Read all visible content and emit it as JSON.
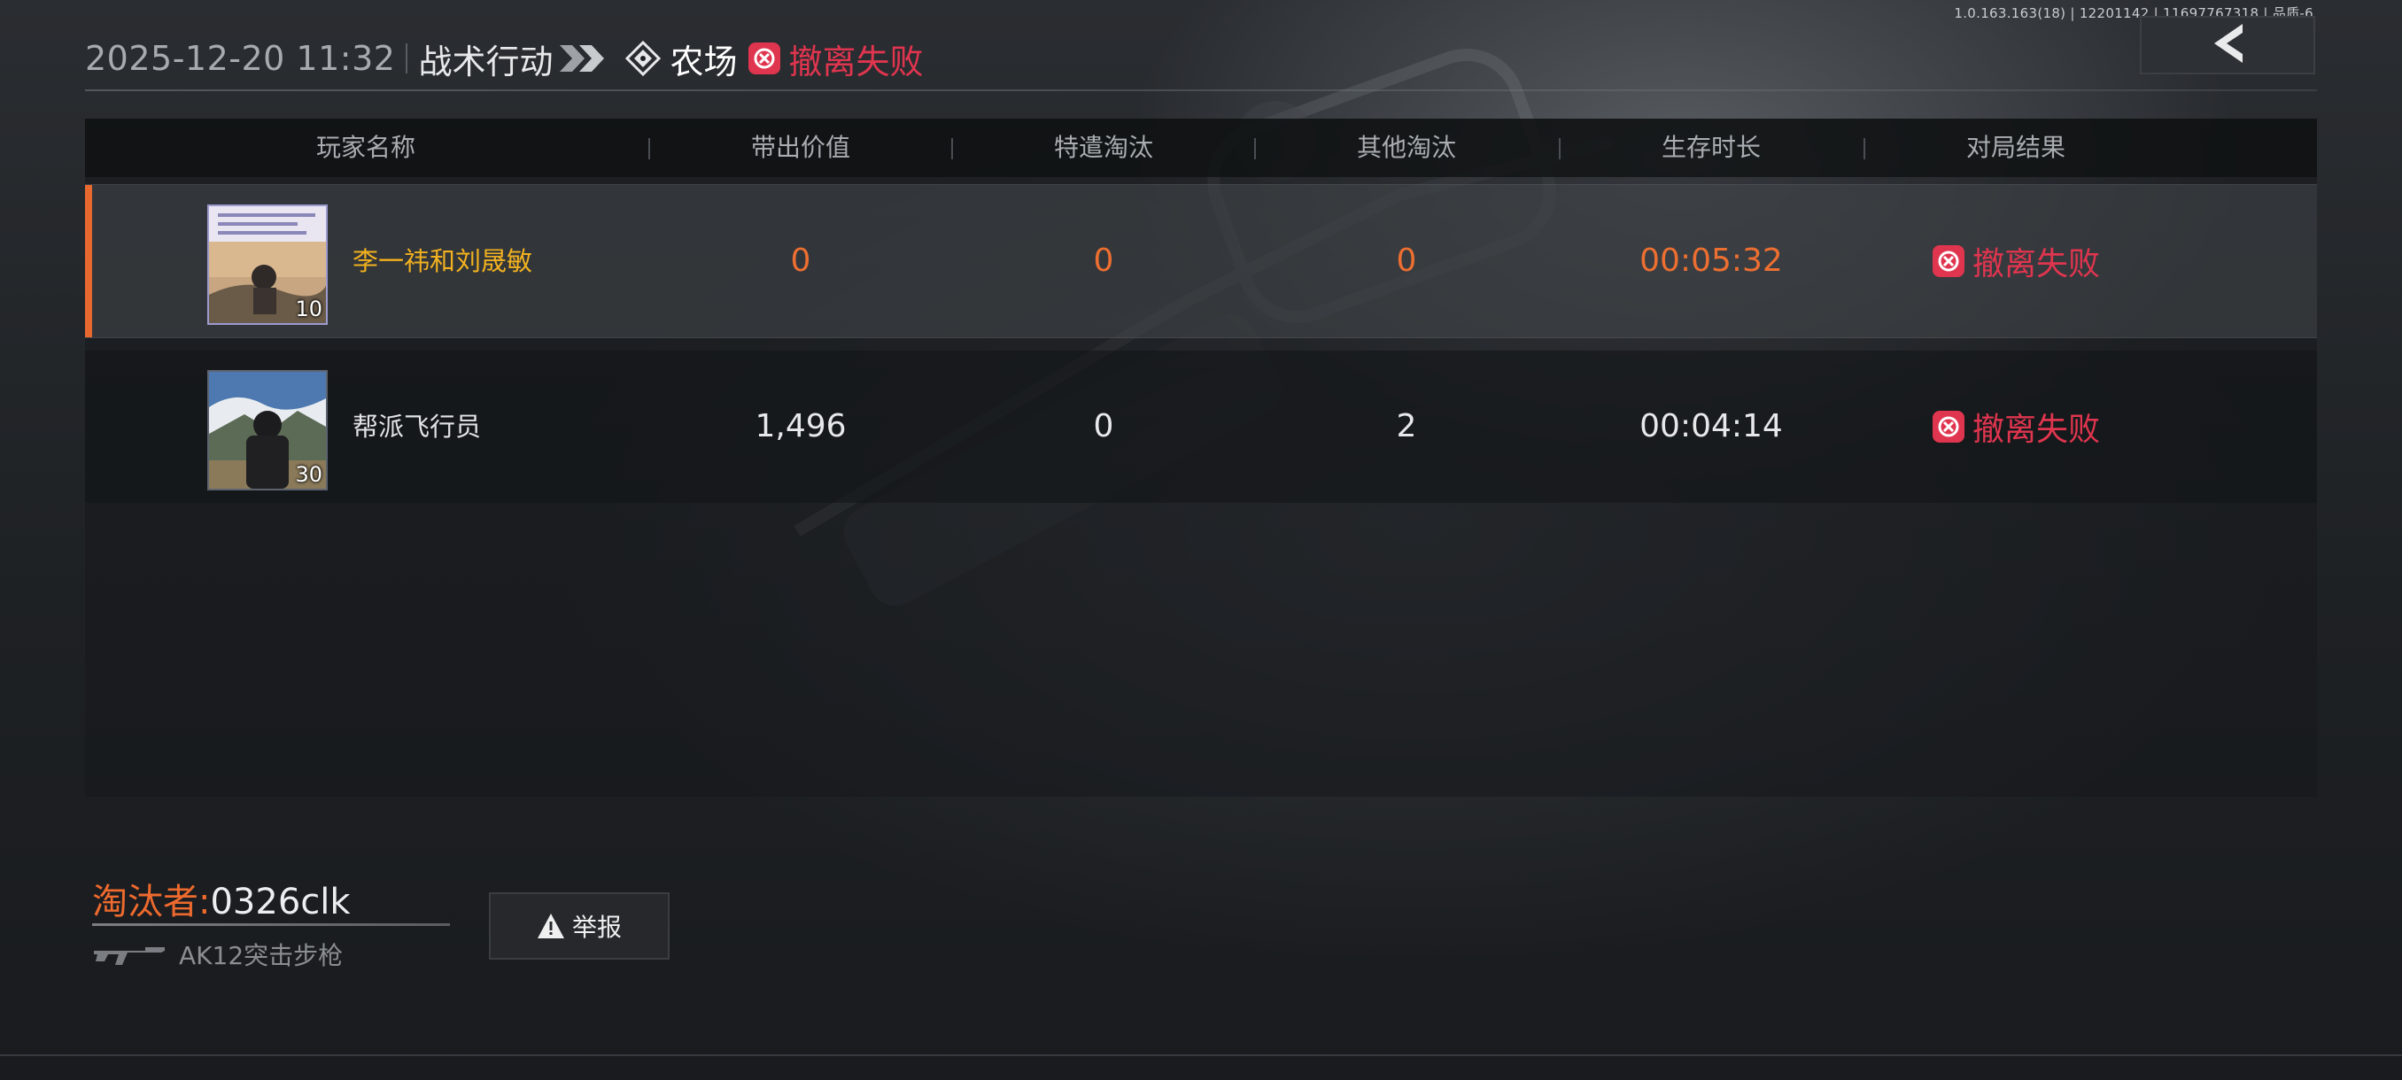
{
  "version_info": "1.0.163.163(18) | 12201142 | 11697767318 | 品质-6",
  "header": {
    "datetime": "2025-12-20 11:32",
    "mode": "战术行动",
    "map": "农场",
    "result": "撤离失败"
  },
  "table": {
    "columns": [
      "玩家名称",
      "带出价值",
      "特遣淘汰",
      "其他淘汰",
      "生存时长",
      "对局结果"
    ],
    "rows": [
      {
        "name": "李一祎和刘晟敏",
        "level": "10",
        "value": "0",
        "special_kills": "0",
        "other_kills": "0",
        "survival": "00:05:32",
        "result": "撤离失败",
        "highlighted": true
      },
      {
        "name": "帮派飞行员",
        "level": "30",
        "value": "1,496",
        "special_kills": "0",
        "other_kills": "2",
        "survival": "00:04:14",
        "result": "撤离失败",
        "highlighted": false
      }
    ]
  },
  "eliminator": {
    "label": "淘汰者:",
    "name": "0326clk",
    "weapon": "AK12突击步枪"
  },
  "report_button": "举报",
  "colors": {
    "accent_orange": "#ec6f31",
    "name_gold": "#f2b11f",
    "fail_red": "#e0354f"
  },
  "icons": {
    "back": "back-arrow-icon",
    "chevrons": "double-chevron-icon",
    "map": "diamond-compass-icon",
    "result": "fail-seal-icon",
    "gun": "rifle-icon",
    "warning": "warning-icon"
  }
}
